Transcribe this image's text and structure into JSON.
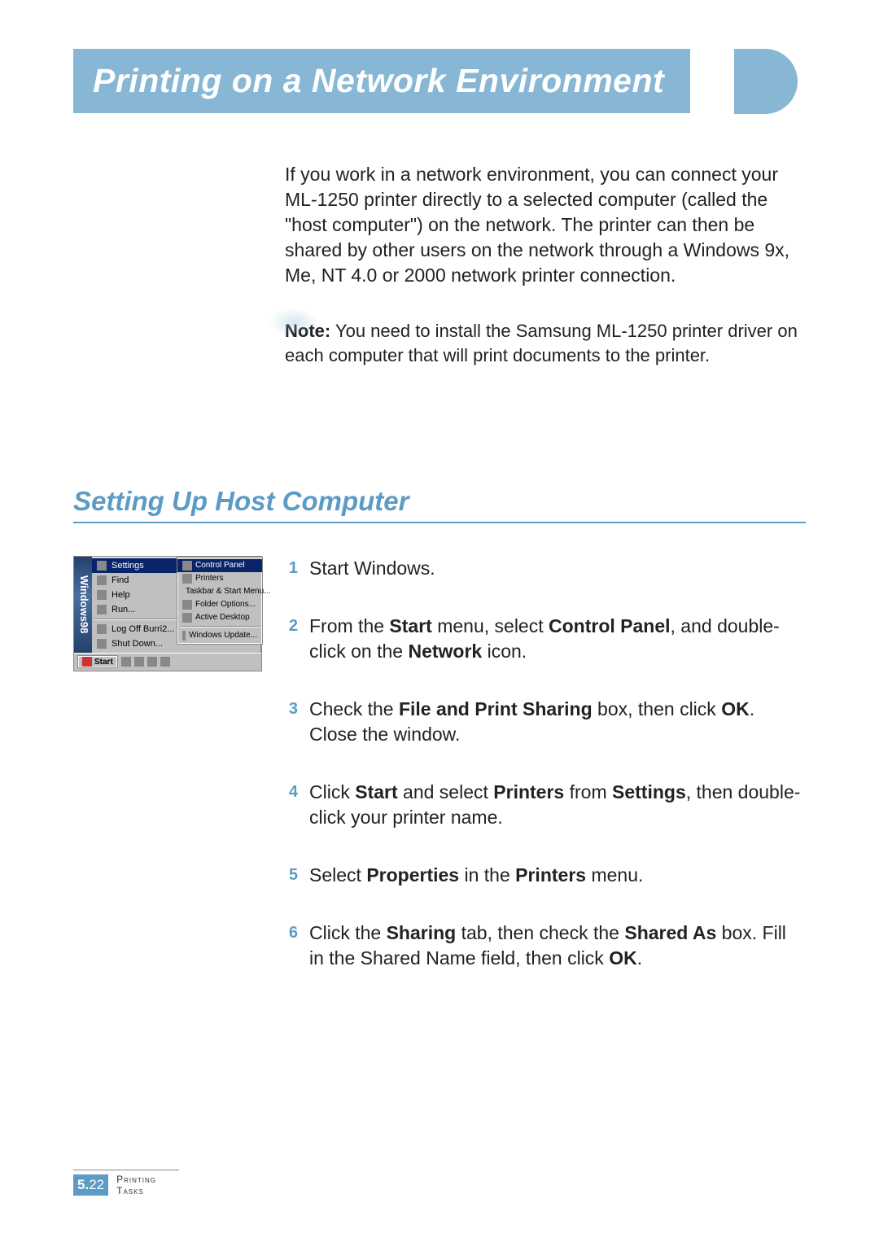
{
  "title": "Printing on a Network Environment",
  "intro": "If you work in a network environment, you can connect your ML-1250 printer directly to a selected computer (called the \"host computer\") on the network. The printer can then be shared  by other users on the network through a Windows 9x, Me, NT 4.0 or 2000 network printer connection.",
  "note": {
    "label": "Note:",
    "text": " You need to install the Samsung ML-1250 printer driver on each computer that will print documents to the printer."
  },
  "section_heading": "Setting Up Host Computer",
  "win98": {
    "sidebar": "Windows98",
    "left": {
      "settings": "Settings",
      "find": "Find",
      "help": "Help",
      "run": "Run...",
      "logoff": "Log Off Burri2...",
      "shutdown": "Shut Down..."
    },
    "submenu": {
      "control_panel": "Control Panel",
      "printers": "Printers",
      "taskbar": "Taskbar & Start Menu...",
      "folder_options": "Folder Options...",
      "active_desktop": "Active Desktop",
      "windows_update": "Windows Update..."
    },
    "start": "Start"
  },
  "steps": {
    "1": "Start Windows.",
    "2_pre": "From the ",
    "2_b1": "Start",
    "2_mid1": " menu, select ",
    "2_b2": "Control Panel",
    "2_mid2": ", and double-click on the ",
    "2_b3": "Network",
    "2_end": " icon.",
    "3_pre": "Check the ",
    "3_b1": "File and Print Sharing",
    "3_mid": " box, then click ",
    "3_b2": "OK",
    "3_end": ". Close the window.",
    "4_pre": "Click ",
    "4_b1": "Start",
    "4_mid1": " and select ",
    "4_b2": "Printers",
    "4_mid2": " from ",
    "4_b3": "Settings",
    "4_end": ", then double-click your printer name.",
    "5_pre": "Select ",
    "5_b1": "Properties",
    "5_mid": " in the ",
    "5_b2": "Printers",
    "5_end": " menu.",
    "6_pre": "Click the ",
    "6_b1": "Sharing",
    "6_mid1": " tab, then check the ",
    "6_b2": "Shared As",
    "6_mid2": " box. Fill in the Shared Name field, then click ",
    "6_b3": "OK",
    "6_end": "."
  },
  "footer": {
    "page_num_prefix": "5.",
    "page_num": "22",
    "label": "Printing Tasks"
  }
}
